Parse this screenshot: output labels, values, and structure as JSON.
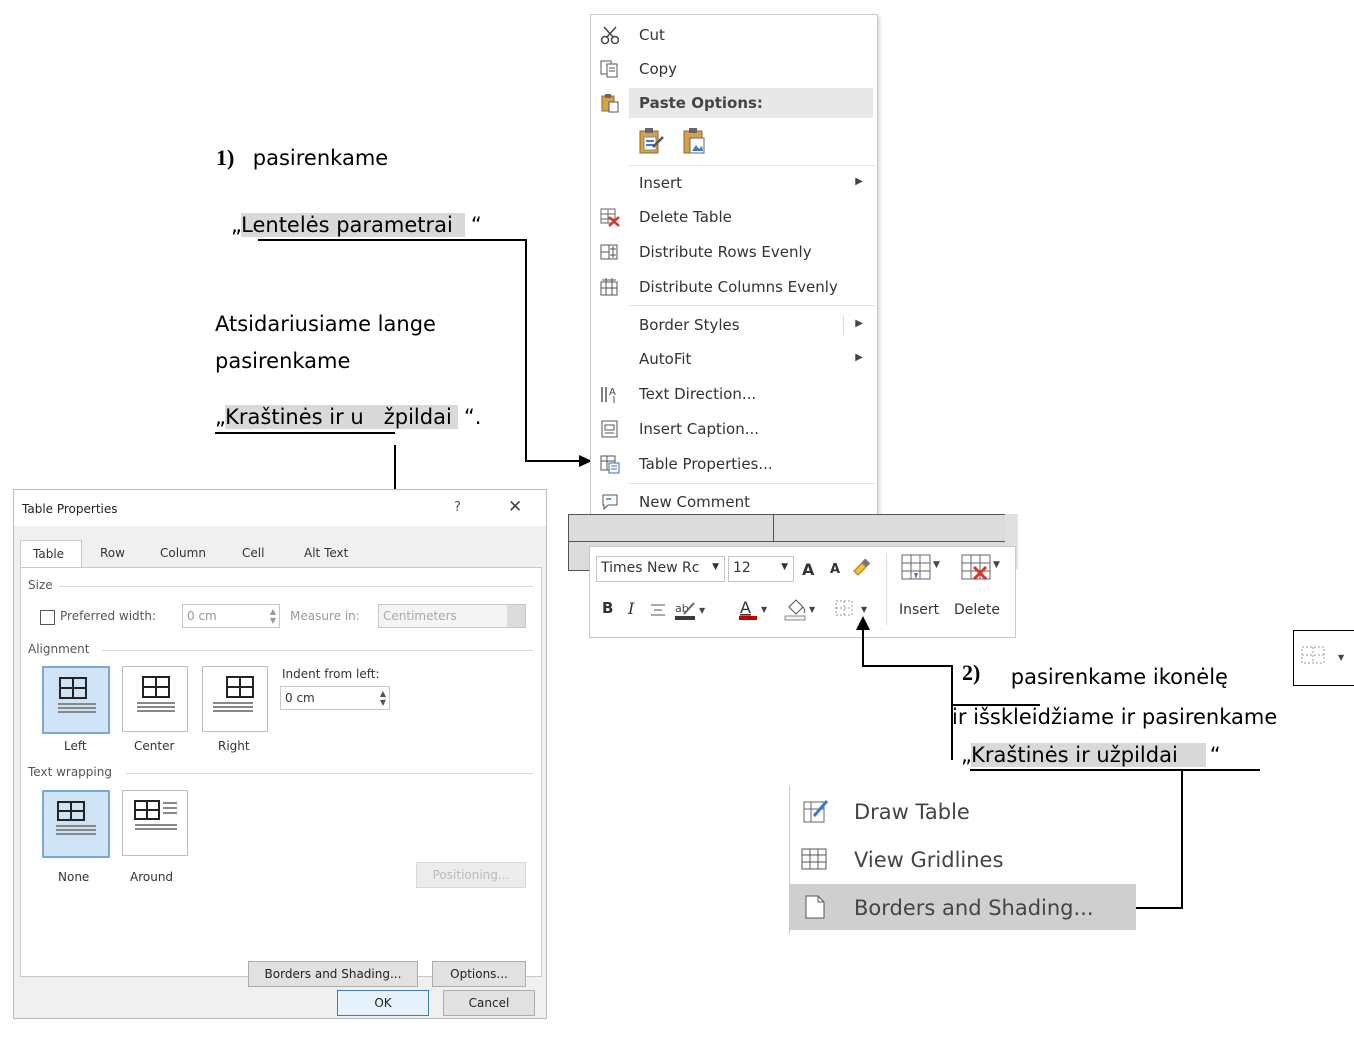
{
  "annotations": {
    "step1_number": "1)",
    "step1_text": "pasirenkame",
    "step1_option_open": "„",
    "step1_option": "Lentelės parametrai",
    "step1_option_close": "“",
    "step1_line2": "Atsidariusiame lange",
    "step1_line3": "pasirenkame",
    "step1_option2_open": "„",
    "step1_option2": "Kraštinės ir u   žpildai",
    "step1_option2_close": "“.",
    "step2_number": "2)",
    "step2_text": "pasirenkame  ikonėlę",
    "step2_line2": "ir išskleidžiame ir pasirenkame",
    "step2_option_open": "„",
    "step2_option": "Kraštinės ir užpildai",
    "step2_option_close": "“"
  },
  "context_menu": {
    "items": [
      {
        "label": "Cut",
        "icon": "scissors-icon"
      },
      {
        "label": "Copy",
        "icon": "copy-icon"
      },
      {
        "label": "Paste Options:",
        "icon": "clipboard-icon"
      },
      {
        "label": "Insert",
        "icon": "",
        "submenu": true
      },
      {
        "label": "Delete Table",
        "icon": "delete-table-icon"
      },
      {
        "label": "Distribute Rows Evenly",
        "icon": "distribute-rows-icon"
      },
      {
        "label": "Distribute Columns Evenly",
        "icon": "distribute-columns-icon"
      },
      {
        "label": "Border Styles",
        "icon": "",
        "submenu": true
      },
      {
        "label": "AutoFit",
        "icon": "",
        "submenu": true
      },
      {
        "label": "Text Direction...",
        "icon": "text-direction-icon"
      },
      {
        "label": "Insert Caption...",
        "icon": "caption-icon"
      },
      {
        "label": "Table Properties...",
        "icon": "table-properties-icon"
      },
      {
        "label": "New Comment",
        "icon": "comment-icon"
      }
    ]
  },
  "mini_toolbar": {
    "font_name": "Times New Rc",
    "font_size": "12",
    "bold": "B",
    "italic": "I",
    "grow_font": "A",
    "shrink_font": "A",
    "insert_label": "Insert",
    "delete_label": "Delete",
    "font_color": "#c00000"
  },
  "dialog": {
    "title": "Table Properties",
    "help": "?",
    "close": "✕",
    "tabs": [
      "Table",
      "Row",
      "Column",
      "Cell",
      "Alt Text"
    ],
    "size_group": "Size",
    "preferred_width_label": "Preferred width:",
    "preferred_width_value": "0 cm",
    "measure_in_label": "Measure in:",
    "measure_in_value": "Centimeters",
    "alignment_group": "Alignment",
    "align_left": "Left",
    "align_center": "Center",
    "align_right": "Right",
    "indent_label": "Indent from left:",
    "indent_value": "0 cm",
    "wrapping_group": "Text wrapping",
    "wrap_none": "None",
    "wrap_around": "Around",
    "positioning_button": "Positioning...",
    "borders_button": "Borders and Shading...",
    "options_button": "Options...",
    "ok_button": "OK",
    "cancel_button": "Cancel"
  },
  "dropdown": {
    "items": [
      {
        "label": "Draw Table",
        "icon": "draw-table-icon"
      },
      {
        "label": "View Gridlines",
        "icon": "gridlines-icon"
      },
      {
        "label": "Borders and Shading...",
        "icon": "borders-shading-icon"
      }
    ]
  }
}
